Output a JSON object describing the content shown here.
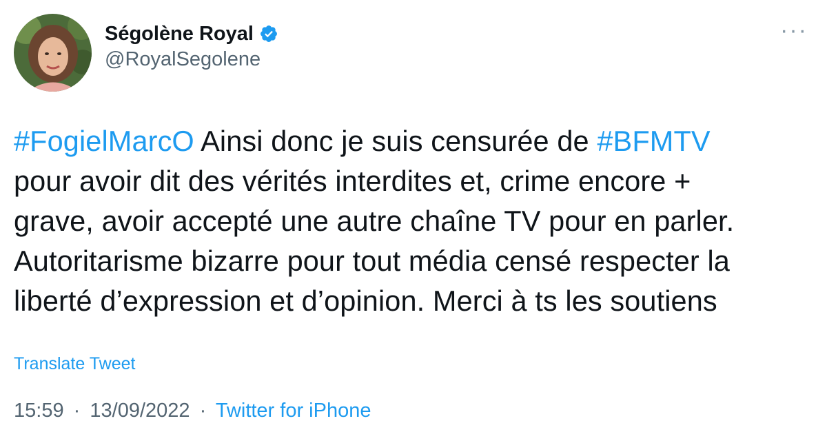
{
  "author": {
    "display_name": "Ségolène Royal",
    "handle": "@RoyalSegolene",
    "verified": true
  },
  "more_menu": {
    "label": "···"
  },
  "tweet": {
    "lines": [
      [
        {
          "text": "#FogielMarcO",
          "hashtag": true
        },
        {
          "text": " Ainsi donc je suis censurée de ",
          "hashtag": false
        },
        {
          "text": "#BFMTV",
          "hashtag": true
        }
      ],
      [
        {
          "text": "pour avoir dit des vérités interdites et, crime encore +",
          "hashtag": false
        }
      ],
      [
        {
          "text": "grave, avoir accepté une autre chaîne TV pour en parler.",
          "hashtag": false
        }
      ],
      [
        {
          "text": "Autoritarisme bizarre pour tout média censé respecter la",
          "hashtag": false
        }
      ],
      [
        {
          "text": "liberté d’expression et d’opinion. Merci à ts les soutiens",
          "hashtag": false
        }
      ]
    ]
  },
  "translate_label": "Translate Tweet",
  "meta": {
    "time": "15:59",
    "separator": "·",
    "date": "13/09/2022",
    "source": "Twitter for iPhone"
  },
  "colors": {
    "link": "#1d9bf0",
    "text": "#0f1419",
    "secondary": "#536471"
  },
  "icons": {
    "verified": "verified-badge-icon",
    "more": "more-options-icon"
  }
}
